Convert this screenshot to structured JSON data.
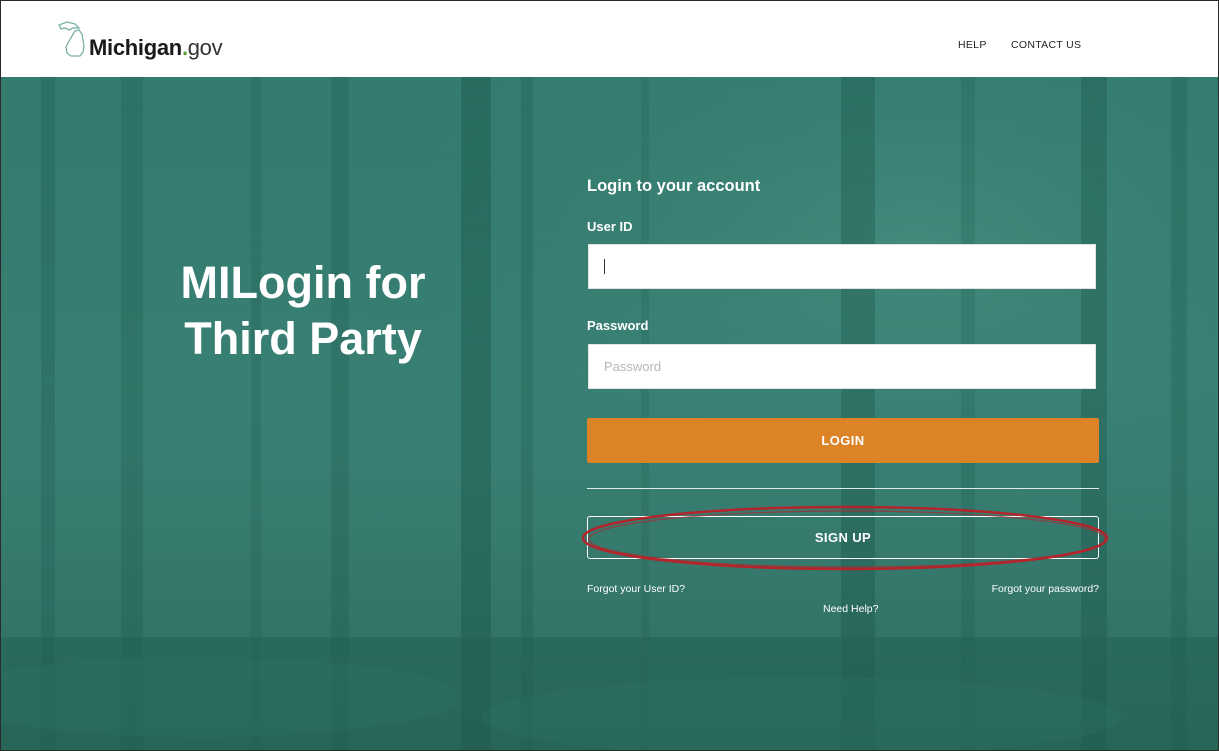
{
  "header": {
    "logo": {
      "bold_text": "Michigan",
      "dot": ".",
      "suffix": "gov"
    },
    "nav": {
      "help": "HELP",
      "contact": "CONTACT US"
    }
  },
  "hero": {
    "title_line1": "MILogin for",
    "title_line2": "Third Party"
  },
  "login": {
    "heading": "Login to your account",
    "user_id_label": "User ID",
    "user_id_value": "",
    "password_label": "Password",
    "password_placeholder": "Password",
    "login_button": "LOGIN",
    "signup_button": "SIGN UP",
    "forgot_user_id": "Forgot your User ID?",
    "forgot_password": "Forgot your password?",
    "need_help": "Need Help?"
  },
  "colors": {
    "hero_teal": "#2a766a",
    "login_orange": "#dc8227",
    "highlight_red": "#b3242b",
    "logo_dot_green": "#5b9f3a"
  },
  "icons": {
    "logo": "michigan-state-outline-icon"
  }
}
